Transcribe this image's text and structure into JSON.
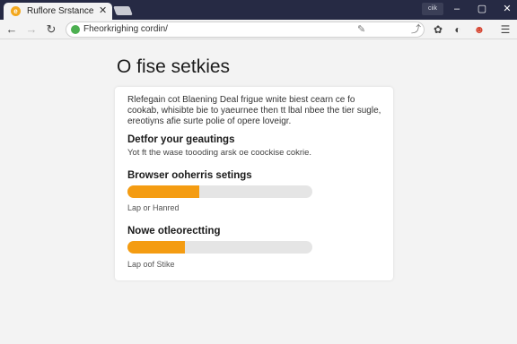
{
  "browser": {
    "tab_title": "Ruflore Srstance",
    "tab_favicon_glyph": "e",
    "window_label": "ciik",
    "url": "Fheorkrighing cordin/"
  },
  "page": {
    "title": "O fise setkies",
    "intro": "Rlefegain cot Blaening Deal frigue wnite biest cearn ce fo cookab, whisibte bie to yaeurnee then tt lbal nbee the tier sugle, ereotiyns afie surte polie of opere loveigr.",
    "section1": {
      "heading": "Detfor your geautings",
      "text": "Yot ft the wase toooding arsk oe coockise cokrie."
    },
    "setting1": {
      "heading": "Browser ooherris setings",
      "caption": "Lap or Hanred",
      "progress": 0.39
    },
    "setting2": {
      "heading": "Nowe otleorectting",
      "caption": "Lap oof Stike",
      "progress": 0.31
    }
  },
  "colors": {
    "accent": "#f49c12",
    "titlebar": "#262a44",
    "secure": "#4caf50"
  },
  "icons": [
    "back-arrow-icon",
    "forward-arrow-icon",
    "reload-icon",
    "lock-icon",
    "translate-icon",
    "share-icon",
    "extension-icon",
    "shield-icon",
    "profile-icon",
    "menu-icon"
  ]
}
